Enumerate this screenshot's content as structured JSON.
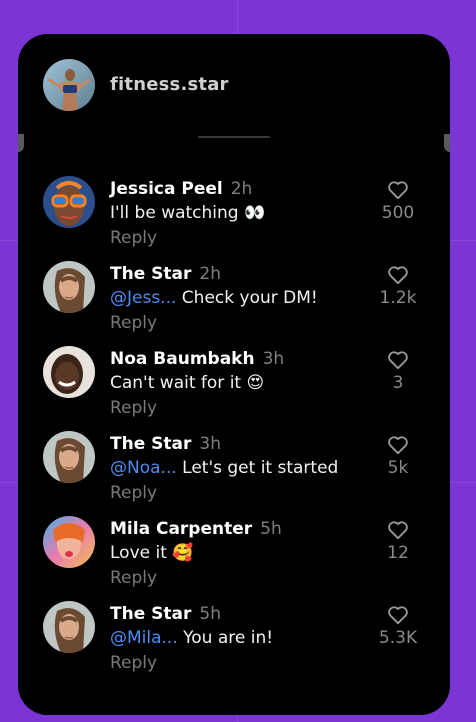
{
  "colors": {
    "background": "#7a35d4",
    "card": "#000000",
    "mention": "#4d8df6",
    "muted": "#7a7a7a"
  },
  "header": {
    "username": "fitness.star",
    "avatar_icon": "fitness-star-avatar"
  },
  "comments": [
    {
      "user": "Jessica Peel",
      "time": "2h",
      "mention": "",
      "text": "I'll be watching 👀",
      "reply": "Reply",
      "likes": "500",
      "avatar_icon": "jessica-avatar"
    },
    {
      "user": "The Star",
      "time": "2h",
      "mention": "@Jess...",
      "text": " Check your DM!",
      "reply": "Reply",
      "likes": "1.2k",
      "avatar_icon": "the-star-avatar"
    },
    {
      "user": "Noa Baumbakh",
      "time": "3h",
      "mention": "",
      "text": "Can't wait for it 😍",
      "reply": "Reply",
      "likes": "3",
      "avatar_icon": "noa-avatar"
    },
    {
      "user": "The Star",
      "time": "3h",
      "mention": "@Noa...",
      "text": " Let's get it started",
      "reply": "Reply",
      "likes": "5k",
      "avatar_icon": "the-star-avatar"
    },
    {
      "user": "Mila Carpenter",
      "time": "5h",
      "mention": "",
      "text": "Love it 🥰",
      "reply": "Reply",
      "likes": "12",
      "avatar_icon": "mila-avatar"
    },
    {
      "user": "The Star",
      "time": "5h",
      "mention": "@Mila...",
      "text": " You are in!",
      "reply": "Reply",
      "likes": "5.3K",
      "avatar_icon": "the-star-avatar"
    }
  ]
}
